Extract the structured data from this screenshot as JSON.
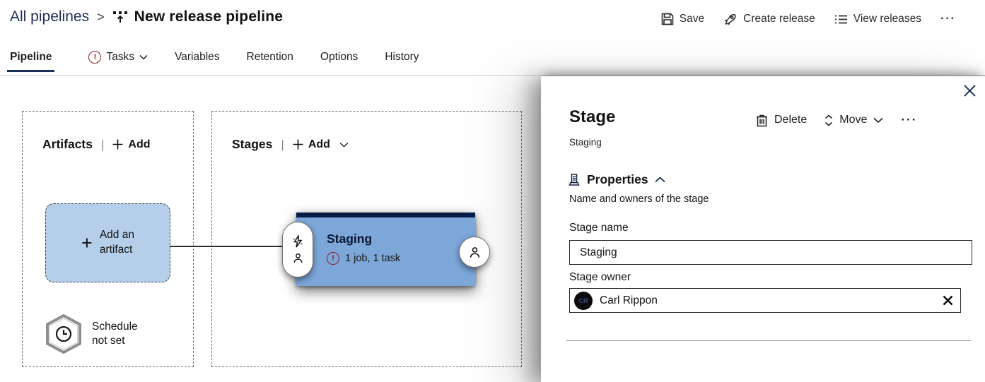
{
  "header": {
    "breadcrumb": {
      "parent": "All pipelines",
      "separator": ">",
      "current": "New release pipeline"
    },
    "commands": {
      "save": "Save",
      "create_release": "Create release",
      "view_releases": "View releases",
      "more": "···"
    }
  },
  "tabs": [
    {
      "label": "Pipeline"
    },
    {
      "label": "Tasks"
    },
    {
      "label": "Variables"
    },
    {
      "label": "Retention"
    },
    {
      "label": "Options"
    },
    {
      "label": "History"
    }
  ],
  "warning_mark": "!",
  "canvas": {
    "artifacts": {
      "title": "Artifacts",
      "divider": "|",
      "add_label": "Add",
      "plus": "+",
      "add_artifact": {
        "line1": "Add an",
        "line2": "artifact"
      },
      "schedule": {
        "line1": "Schedule",
        "line2": "not set"
      }
    },
    "stages": {
      "title": "Stages",
      "divider": "|",
      "add_label": "Add",
      "stage": {
        "name": "Staging",
        "summary": "1 job, 1 task"
      }
    }
  },
  "panel": {
    "title": "Stage",
    "subtitle": "Staging",
    "actions": {
      "delete": "Delete",
      "move": "Move",
      "more": "···"
    },
    "properties": {
      "title": "Properties",
      "description": "Name and owners of the stage"
    },
    "fields": {
      "stage_name": {
        "label": "Stage name",
        "value": "Staging"
      },
      "stage_owner": {
        "label": "Stage owner",
        "value": "Carl Rippon",
        "initials": "CR"
      }
    }
  },
  "colors": {
    "accent_navy": "#1b2e55",
    "stage_blue": "#7da7d9",
    "stage_topbar": "#081c49",
    "warning_red": "#871f26",
    "artifact_fill": "#b5cfeb"
  }
}
